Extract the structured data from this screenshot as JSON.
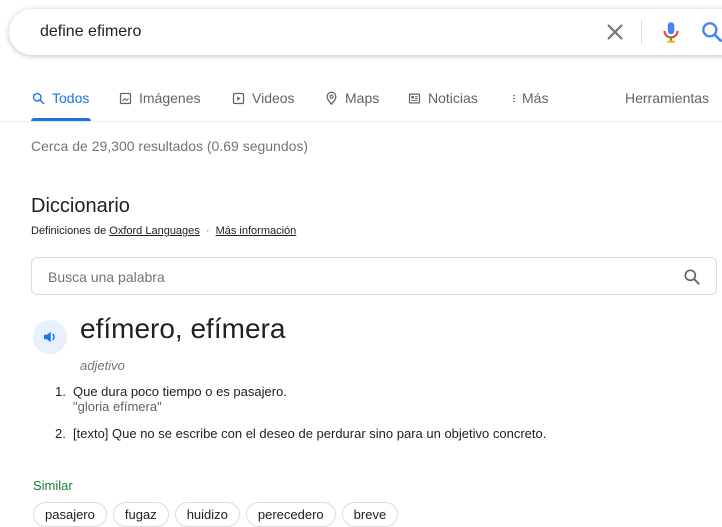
{
  "search": {
    "query": "define efimero"
  },
  "tabs": [
    {
      "label": "Todos",
      "icon": "search-icon",
      "active": true
    },
    {
      "label": "Imágenes",
      "icon": "image-icon"
    },
    {
      "label": "Videos",
      "icon": "video-icon"
    },
    {
      "label": "Maps",
      "icon": "map-pin-icon"
    },
    {
      "label": "Noticias",
      "icon": "news-icon"
    },
    {
      "label": "Más",
      "icon": "more-icon"
    },
    {
      "label": "Herramientas"
    }
  ],
  "stats": "Cerca de 29,300 resultados (0.69 segundos)",
  "dictionary": {
    "title": "Diccionario",
    "source_prefix": "Definiciones de",
    "source_link": "Oxford Languages",
    "source_sep": "·",
    "more_info": "Más información",
    "search_placeholder": "Busca una palabra",
    "headword": "efímero, efímera",
    "part_of_speech": "adjetivo",
    "definitions": [
      {
        "number": "1.",
        "text": "Que dura poco tiempo o es pasajero.",
        "example": "\"gloria efímera\""
      },
      {
        "number": "2.",
        "text": "[texto] Que no se escribe con el deseo de perdurar sino para un objetivo concreto."
      }
    ],
    "similar_label": "Similar",
    "similar": [
      "pasajero",
      "fugaz",
      "huidizo",
      "perecedero",
      "breve"
    ]
  },
  "colors": {
    "accent": "#1a73e8",
    "green": "#188038",
    "muted": "#70757a"
  }
}
